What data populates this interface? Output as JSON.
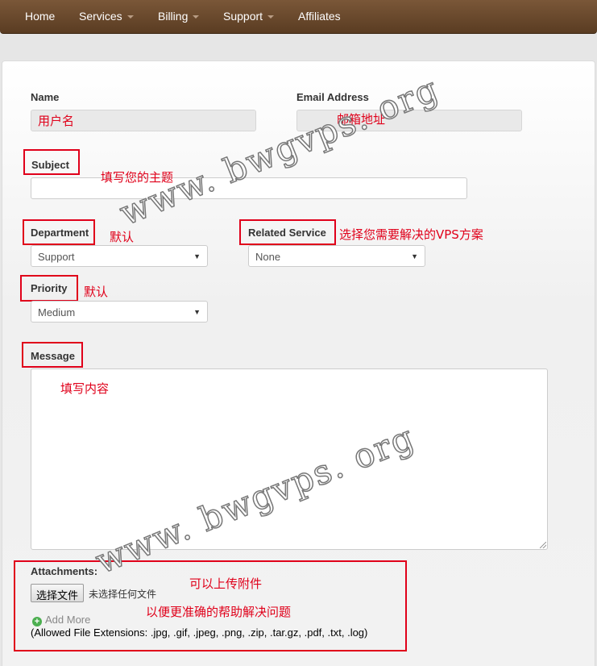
{
  "nav": [
    {
      "label": "Home",
      "dropdown": false
    },
    {
      "label": "Services",
      "dropdown": true
    },
    {
      "label": "Billing",
      "dropdown": true
    },
    {
      "label": "Support",
      "dropdown": true
    },
    {
      "label": "Affiliates",
      "dropdown": false
    }
  ],
  "form": {
    "name_label": "Name",
    "email_label": "Email Address",
    "subject_label": "Subject",
    "department_label": "Department",
    "department_value": "Support",
    "related_service_label": "Related Service",
    "related_service_value": "None",
    "priority_label": "Priority",
    "priority_value": "Medium",
    "message_label": "Message",
    "attachments_label": "Attachments:",
    "file_button": "选择文件",
    "no_file": "未选择任何文件",
    "add_more": "Add More",
    "allowed_ext": "(Allowed File Extensions: .jpg, .gif, .jpeg, .png, .zip, .tar.gz, .pdf, .txt, .log)"
  },
  "annotations": {
    "name_hint": "用户名",
    "email_hint": "邮箱地址",
    "subject_hint": "填写您的主题",
    "department_hint": "默认",
    "related_service_hint": "选择您需要解决的VPS方案",
    "priority_hint": "默认",
    "message_hint": "填写内容",
    "attach_hint1": "可以上传附件",
    "attach_hint2": "以便更准确的帮助解决问题"
  },
  "watermark": "www. bwgvps. org",
  "colors": {
    "annotation": "#e0001a",
    "navbar": "#6a4a2c"
  }
}
